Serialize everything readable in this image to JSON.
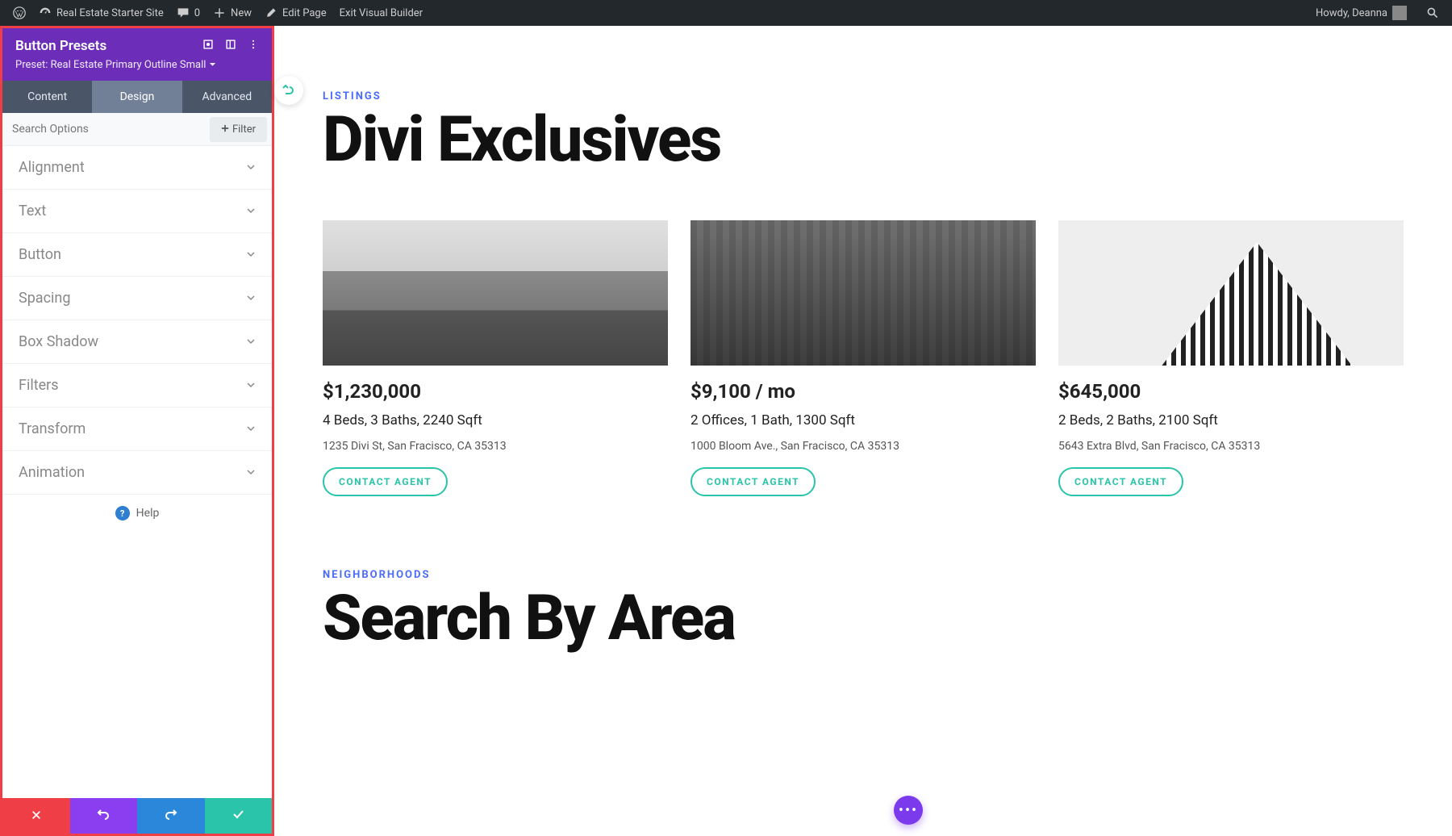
{
  "adminBar": {
    "siteName": "Real Estate Starter Site",
    "comments": "0",
    "new": "New",
    "editPage": "Edit Page",
    "exitBuilder": "Exit Visual Builder",
    "howdy": "Howdy, Deanna"
  },
  "panel": {
    "title": "Button Presets",
    "presetLabel": "Preset: Real Estate Primary Outline Small",
    "tabs": {
      "content": "Content",
      "design": "Design",
      "advanced": "Advanced"
    },
    "searchPlaceholder": "Search Options",
    "filterLabel": "Filter",
    "options": [
      "Alignment",
      "Text",
      "Button",
      "Spacing",
      "Box Shadow",
      "Filters",
      "Transform",
      "Animation"
    ],
    "help": "Help"
  },
  "page": {
    "section1Label": "LISTINGS",
    "section1Title": "Divi Exclusives",
    "section2Label": "NEIGHBORHOODS",
    "section2Title": "Search By Area"
  },
  "listings": [
    {
      "price": "$1,230,000",
      "specs": "4 Beds, 3 Baths, 2240 Sqft",
      "address": "1235 Divi St, San Fracisco, CA 35313",
      "cta": "CONTACT AGENT"
    },
    {
      "price": "$9,100 / mo",
      "specs": "2 Offices, 1 Bath, 1300 Sqft",
      "address": "1000 Bloom Ave., San Fracisco, CA 35313",
      "cta": "CONTACT AGENT"
    },
    {
      "price": "$645,000",
      "specs": "2 Beds, 2 Baths, 2100 Sqft",
      "address": "5643 Extra Blvd, San Fracisco, CA 35313",
      "cta": "CONTACT AGENT"
    }
  ]
}
